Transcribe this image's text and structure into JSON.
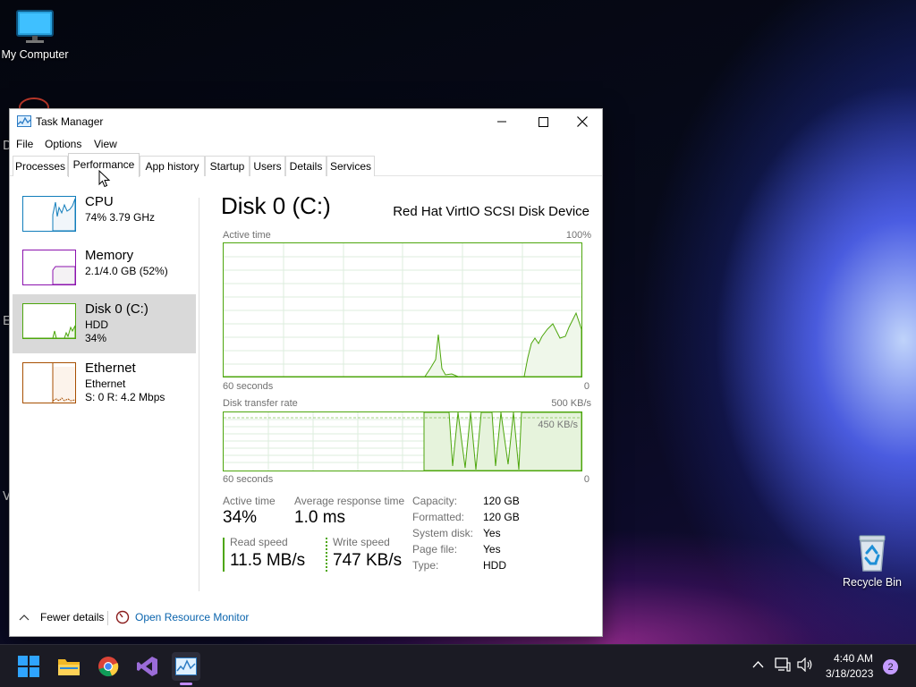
{
  "desktop": {
    "my_computer_label": "My Computer",
    "recycle_bin_label": "Recycle Bin",
    "edge_letters": [
      "D",
      "E",
      "V"
    ]
  },
  "window": {
    "title": "Task Manager",
    "menu": [
      "File",
      "Options",
      "View"
    ],
    "tabs": [
      "Processes",
      "Performance",
      "App history",
      "Startup",
      "Users",
      "Details",
      "Services"
    ],
    "active_tab": "Performance"
  },
  "sidebar": [
    {
      "name": "CPU",
      "sub1": "74% 3.79 GHz",
      "sub2": "",
      "color": "#117dbb",
      "fill": "#f1f6fa"
    },
    {
      "name": "Memory",
      "sub1": "2.1/4.0 GB (52%)",
      "sub2": "",
      "color": "#8b12ae",
      "fill": "#f4f2f4"
    },
    {
      "name": "Disk 0 (C:)",
      "sub1": "HDD",
      "sub2": "34%",
      "color": "#4da60c",
      "fill": "#eff7ea",
      "selected": true
    },
    {
      "name": "Ethernet",
      "sub1": "Ethernet",
      "sub2": "S: 0 R: 4.2 Mbps",
      "color": "#a74f01",
      "fill": "#fcf3eb"
    }
  ],
  "detail": {
    "title": "Disk 0 (C:)",
    "device": "Red Hat VirtIO SCSI Disk Device",
    "graph1": {
      "label": "Active time",
      "max": "100%",
      "xl": "60 seconds",
      "xr": "0"
    },
    "graph2": {
      "label": "Disk transfer rate",
      "max": "500 KB/s",
      "line_label": "450 KB/s",
      "xl": "60 seconds",
      "xr": "0"
    },
    "active_time_label": "Active time",
    "active_time_value": "34%",
    "avg_resp_label": "Average response time",
    "avg_resp_value": "1.0 ms",
    "read_label": "Read speed",
    "read_value": "11.5 MB/s",
    "write_label": "Write speed",
    "write_value": "747 KB/s",
    "props": [
      {
        "k": "Capacity:",
        "v": "120 GB"
      },
      {
        "k": "Formatted:",
        "v": "120 GB"
      },
      {
        "k": "System disk:",
        "v": "Yes"
      },
      {
        "k": "Page file:",
        "v": "Yes"
      },
      {
        "k": "Type:",
        "v": "HDD"
      }
    ]
  },
  "footer": {
    "fewer_details": "Fewer details",
    "resource_monitor": "Open Resource Monitor"
  },
  "taskbar": {
    "time": "4:40 AM",
    "date": "3/18/2023",
    "notification_count": "2",
    "apps": [
      "start-icon",
      "file-explorer-icon",
      "chrome-icon",
      "visual-studio-icon",
      "task-manager-icon"
    ]
  },
  "colors": {
    "disk_green": "#4da60c",
    "accent_blue": "#0a64ad"
  }
}
